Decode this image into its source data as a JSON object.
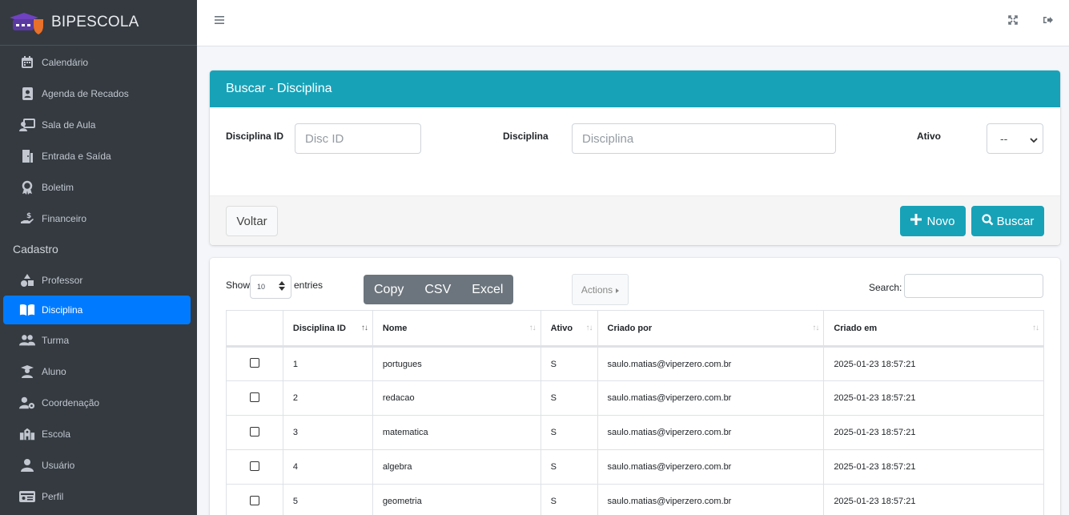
{
  "brand": {
    "name": "BIPESCOLA"
  },
  "sidebar": {
    "items": [
      {
        "label": "Calendário",
        "icon": "calendar-icon"
      },
      {
        "label": "Agenda de Recados",
        "icon": "contact-book-icon"
      },
      {
        "label": "Sala de Aula",
        "icon": "chalkboard-teacher-icon"
      },
      {
        "label": "Entrada e Saída",
        "icon": "door-icon"
      },
      {
        "label": "Boletim",
        "icon": "award-icon"
      },
      {
        "label": "Financeiro",
        "icon": "hand-dollar-icon"
      }
    ],
    "section": "Cadastro",
    "cadastro_items": [
      {
        "label": "Professor",
        "icon": "shapes-icon"
      },
      {
        "label": "Disciplina",
        "icon": "book-open-icon",
        "active": true
      },
      {
        "label": "Turma",
        "icon": "users-icon"
      },
      {
        "label": "Aluno",
        "icon": "user-graduate-icon"
      },
      {
        "label": "Coordenação",
        "icon": "user-cog-icon"
      },
      {
        "label": "Escola",
        "icon": "school-icon"
      },
      {
        "label": "Usuário",
        "icon": "user-icon"
      },
      {
        "label": "Perfil",
        "icon": "id-card-icon"
      }
    ]
  },
  "search_card": {
    "title": "Buscar - Disciplina",
    "fields": {
      "disc_id_label": "Disciplina ID",
      "disc_id_placeholder": "Disc ID",
      "disciplina_label": "Disciplina",
      "disciplina_placeholder": "Disciplina",
      "ativo_label": "Ativo",
      "ativo_value": "--"
    },
    "buttons": {
      "voltar": "Voltar",
      "novo": "Novo",
      "buscar": "Buscar"
    }
  },
  "table_card": {
    "show_label": "Show",
    "entries_value": "10",
    "entries_label": "entries",
    "export_buttons": [
      "Copy",
      "CSV",
      "Excel"
    ],
    "actions_label": "Actions",
    "search_label": "Search:",
    "columns": [
      "",
      "Disciplina ID",
      "Nome",
      "Ativo",
      "Criado por",
      "Criado em"
    ],
    "rows": [
      [
        "1",
        "portugues",
        "S",
        "saulo.matias@viperzero.com.br",
        "2025-01-23 18:57:21"
      ],
      [
        "2",
        "redacao",
        "S",
        "saulo.matias@viperzero.com.br",
        "2025-01-23 18:57:21"
      ],
      [
        "3",
        "matematica",
        "S",
        "saulo.matias@viperzero.com.br",
        "2025-01-23 18:57:21"
      ],
      [
        "4",
        "algebra",
        "S",
        "saulo.matias@viperzero.com.br",
        "2025-01-23 18:57:21"
      ],
      [
        "5",
        "geometria",
        "S",
        "saulo.matias@viperzero.com.br",
        "2025-01-23 18:57:21"
      ]
    ]
  },
  "colors": {
    "sidebar": "#343a40",
    "active": "#007bff",
    "header": "#17a2b8",
    "export": "#6c757d"
  }
}
